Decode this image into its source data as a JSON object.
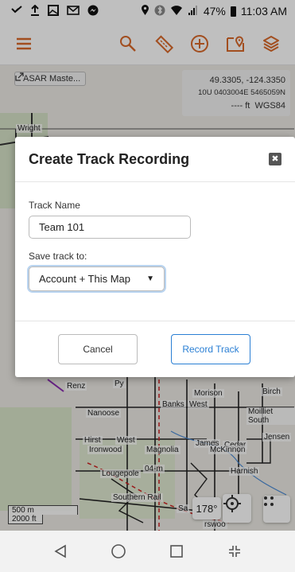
{
  "status_bar": {
    "left_icons": [
      "missed-call-icon",
      "upload-icon",
      "image-icon",
      "gmail-icon",
      "messenger-icon"
    ],
    "right_icons": [
      "location-icon",
      "bluetooth-icon",
      "wifi-icon",
      "signal-icon"
    ],
    "battery": "47%",
    "time": "11:03 AM"
  },
  "toolbar": {
    "icons": [
      "menu-icon",
      "search-icon",
      "ruler-icon",
      "add-icon",
      "map-pin-icon",
      "layers-icon"
    ],
    "accent": "#d9682a"
  },
  "map": {
    "layer_chip": "ASAR Maste...",
    "coords": {
      "latlng": "49.3305, -124.3350",
      "utm": "10U 0403004E 5465059N",
      "elev": "---- ft",
      "datum": "WGS84"
    },
    "street_labels": [
      "Wright",
      "Renz",
      "Py",
      "Morison",
      "Birch",
      "Banks",
      "West",
      "Moilliet South",
      "Nanoose",
      "Jensen",
      "Hirst",
      "West",
      "Ironwood",
      "James",
      "Cedar",
      "McKinnon",
      "Magnolia",
      "Harnish",
      "Lougepole",
      "Southern Rail",
      "Sa",
      "rswoo",
      "04-m"
    ],
    "scale": {
      "metric": "500 m",
      "imperial": "2000 ft"
    },
    "heading": "178°"
  },
  "dialog": {
    "title": "Create Track Recording",
    "track_name_label": "Track Name",
    "track_name_value": "Team 101",
    "save_to_label": "Save track to:",
    "save_to_value": "Account + This Map",
    "cancel_label": "Cancel",
    "record_label": "Record Track",
    "primary_color": "#2a7fd4"
  },
  "nav_bar": {
    "icons": [
      "back-icon",
      "home-icon",
      "recents-icon",
      "screen-fit-icon"
    ]
  }
}
